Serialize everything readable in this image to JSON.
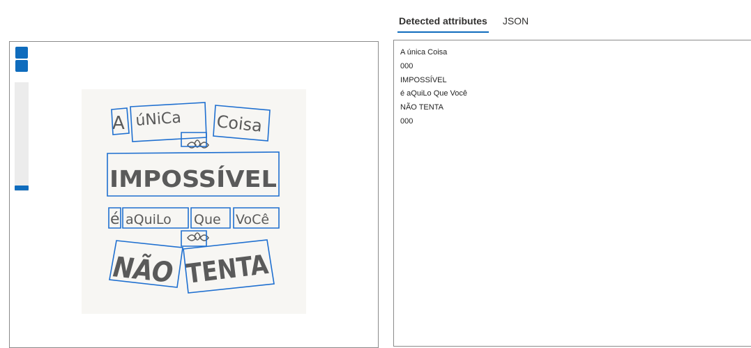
{
  "tabs": [
    {
      "label": "Detected attributes",
      "active": true
    },
    {
      "label": "JSON",
      "active": false
    }
  ],
  "zoom": {
    "zoom_in_icon": "zoom-in-icon",
    "zoom_out_icon": "zoom-out-icon",
    "level": 0
  },
  "image_words": {
    "w1": "A",
    "w2": "úNiCa",
    "w3": "Coisa",
    "w4": "IMPOSSÍVEL",
    "w5": "é",
    "w6": "aQuiLo",
    "w7": "Que",
    "w8": "VoCê",
    "w9": "NÃO",
    "w10": "TENTA"
  },
  "detected_lines": [
    "A única Coisa",
    "000",
    "IMPOSSÍVEL",
    "é aQuiLo Que Você",
    "NÃO TENTA",
    "000"
  ],
  "colors": {
    "accent": "#0f6cbd",
    "box": "#1e6fd0",
    "ink": "#5a5a5a"
  }
}
